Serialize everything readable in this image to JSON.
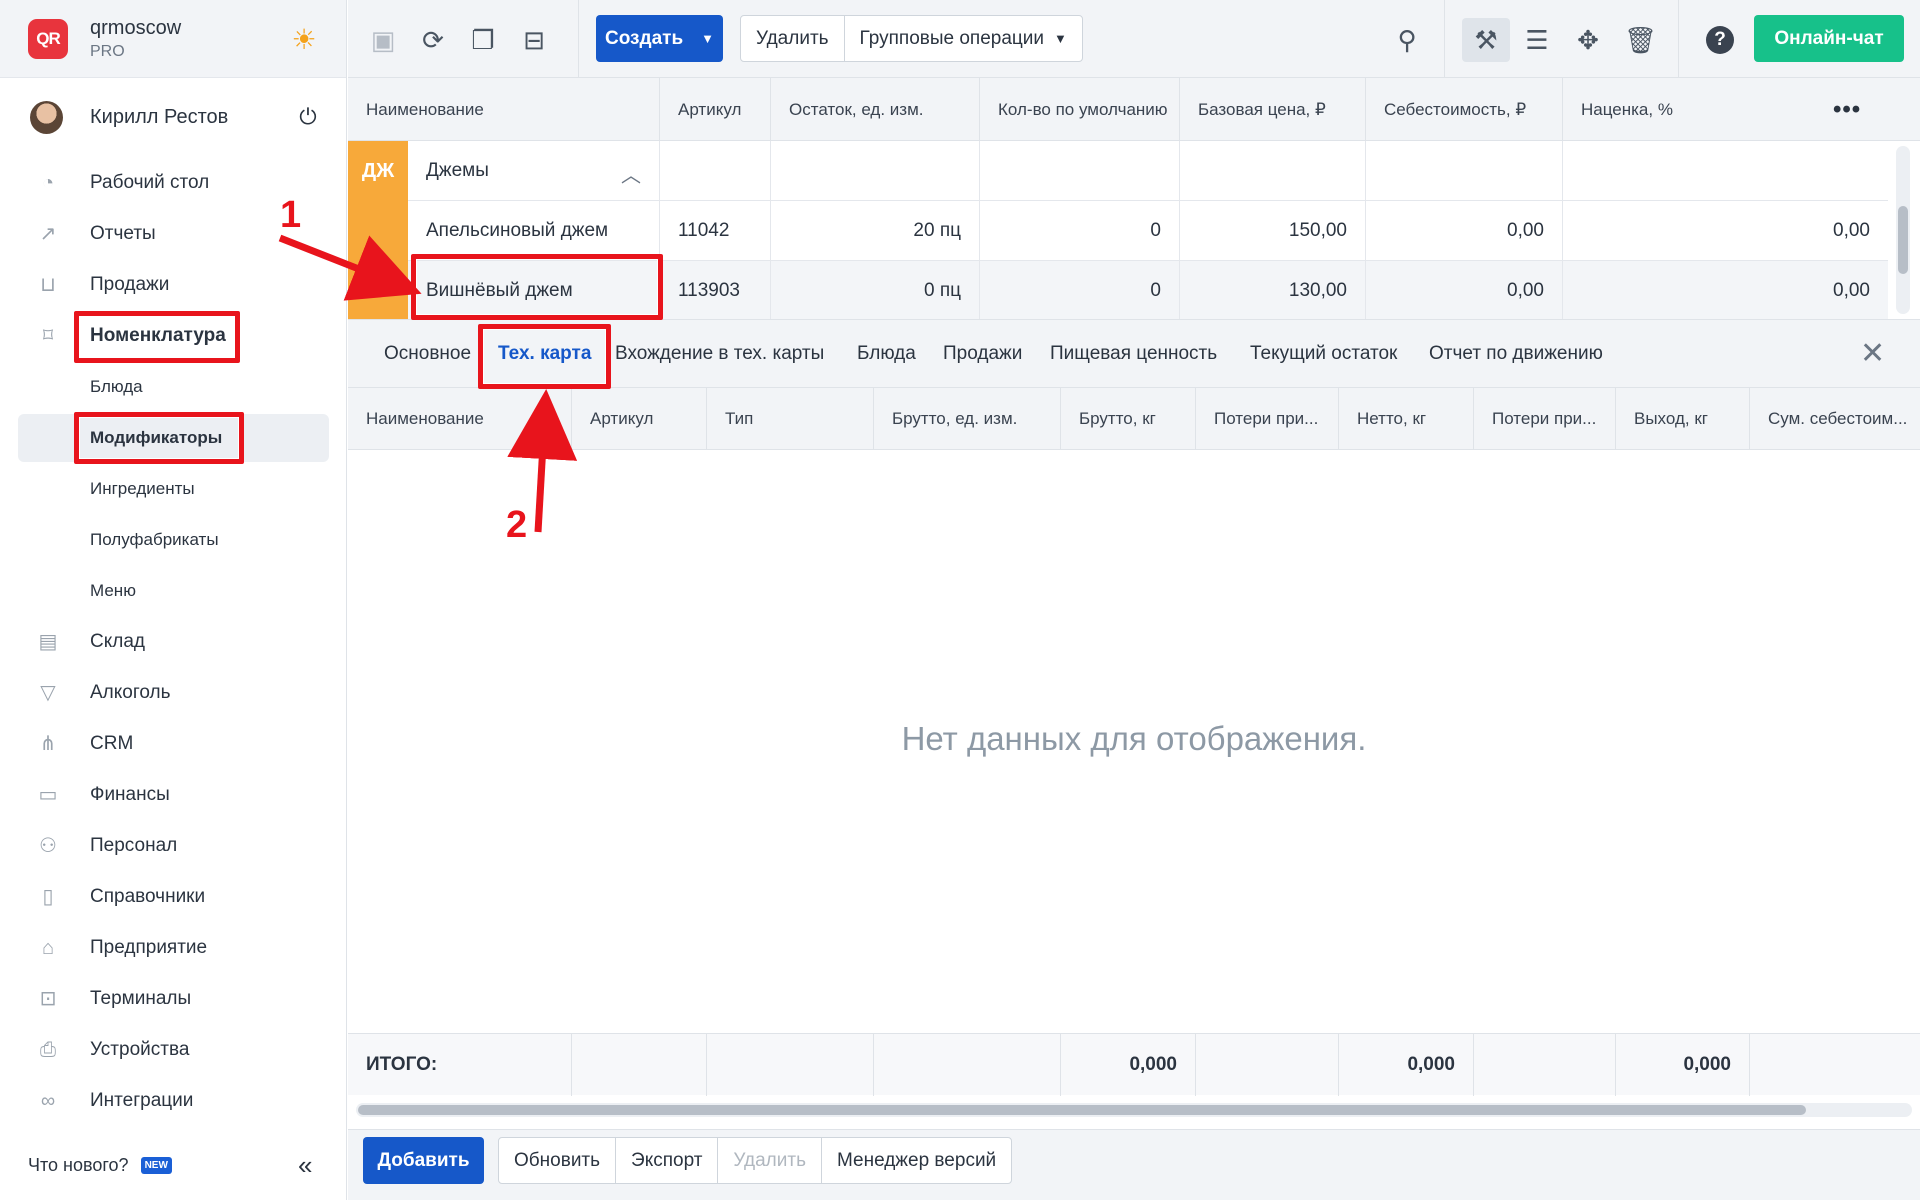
{
  "brand": {
    "name": "qrmoscow",
    "plan": "PRO",
    "logo_text": "QR",
    "logo_icon": "qr-logo-icon",
    "theme_icon": "sun-icon"
  },
  "user": {
    "name": "Кирилл Рестов",
    "avatar_icon": "avatar",
    "logout_icon": "power-icon"
  },
  "nav": {
    "items": [
      {
        "label": "Рабочий стол",
        "icon": "dashboard-icon"
      },
      {
        "label": "Отчеты",
        "icon": "chart-icon"
      },
      {
        "label": "Продажи",
        "icon": "basket-icon"
      },
      {
        "label": "Номенклатура",
        "icon": "tag-icon"
      },
      {
        "label": "Блюда"
      },
      {
        "label": "Модификаторы"
      },
      {
        "label": "Ингредиенты"
      },
      {
        "label": "Полуфабрикаты"
      },
      {
        "label": "Меню"
      },
      {
        "label": "Склад",
        "icon": "archive-icon"
      },
      {
        "label": "Алкоголь",
        "icon": "cocktail-icon"
      },
      {
        "label": "CRM",
        "icon": "crm-icon"
      },
      {
        "label": "Финансы",
        "icon": "wallet-icon"
      },
      {
        "label": "Персонал",
        "icon": "people-icon"
      },
      {
        "label": "Справочники",
        "icon": "book-icon"
      },
      {
        "label": "Предприятие",
        "icon": "store-icon"
      },
      {
        "label": "Терминалы",
        "icon": "terminal-icon"
      },
      {
        "label": "Устройства",
        "icon": "printer-icon"
      },
      {
        "label": "Интеграции",
        "icon": "infinity-icon"
      }
    ],
    "footer": {
      "whats_new": "Что нового?",
      "badge": "NEW"
    }
  },
  "toolbar": {
    "create_label": "Создать",
    "delete_label": "Удалить",
    "group_ops_label": "Групповые операции",
    "chat_label": "Онлайн-чат",
    "icons": [
      "save-icon",
      "refresh-icon",
      "copy-icon",
      "inbox-icon",
      "search-icon",
      "tools-icon",
      "list-icon",
      "move-icon",
      "trash-icon",
      "help-icon"
    ]
  },
  "grid": {
    "columns": [
      "Наименование",
      "Артикул",
      "Остаток, ед. изм.",
      "Кол-во по умолчанию",
      "Базовая цена, ₽",
      "Себестоимость, ₽",
      "Наценка, %"
    ],
    "group": {
      "badge": "ДЖ",
      "name": "Джемы"
    },
    "rows": [
      {
        "name": "Апельсиновый джем",
        "sku": "11042",
        "stock": "20 пц",
        "default_qty": "0",
        "base_price": "150,00",
        "cost": "0,00",
        "markup": "0,00"
      },
      {
        "name": "Вишнёвый джем",
        "sku": "113903",
        "stock": "0 пц",
        "default_qty": "0",
        "base_price": "130,00",
        "cost": "0,00",
        "markup": "0,00"
      }
    ]
  },
  "detail": {
    "tabs": [
      "Основное",
      "Тех. карта",
      "Вхождение в тех. карты",
      "Блюда",
      "Продажи",
      "Пищевая ценность",
      "Текущий остаток",
      "Отчет по движению"
    ],
    "active_tab": "Тех. карта",
    "columns": [
      "Наименование",
      "Артикул",
      "Тип",
      "Брутто, ед. изм.",
      "Брутто, кг",
      "Потери при...",
      "Нетто, кг",
      "Потери при...",
      "Выход, кг",
      "Сум. себестоим..."
    ],
    "empty_message": "Нет данных для отображения.",
    "totals": {
      "label": "ИТОГО:",
      "brutto_kg": "0,000",
      "netto_kg": "0,000",
      "output_kg": "0,000"
    }
  },
  "bottom_bar": {
    "add_label": "Добавить",
    "refresh_label": "Обновить",
    "export_label": "Экспорт",
    "delete_label": "Удалить",
    "versions_label": "Менеджер версий"
  },
  "annotations": {
    "step1": "1",
    "step2": "2",
    "color": "#e8141c"
  },
  "colors": {
    "primary": "#1658c9",
    "chat": "#17c18a",
    "group_badge": "#f7a93a",
    "logo": "#e8343d"
  }
}
